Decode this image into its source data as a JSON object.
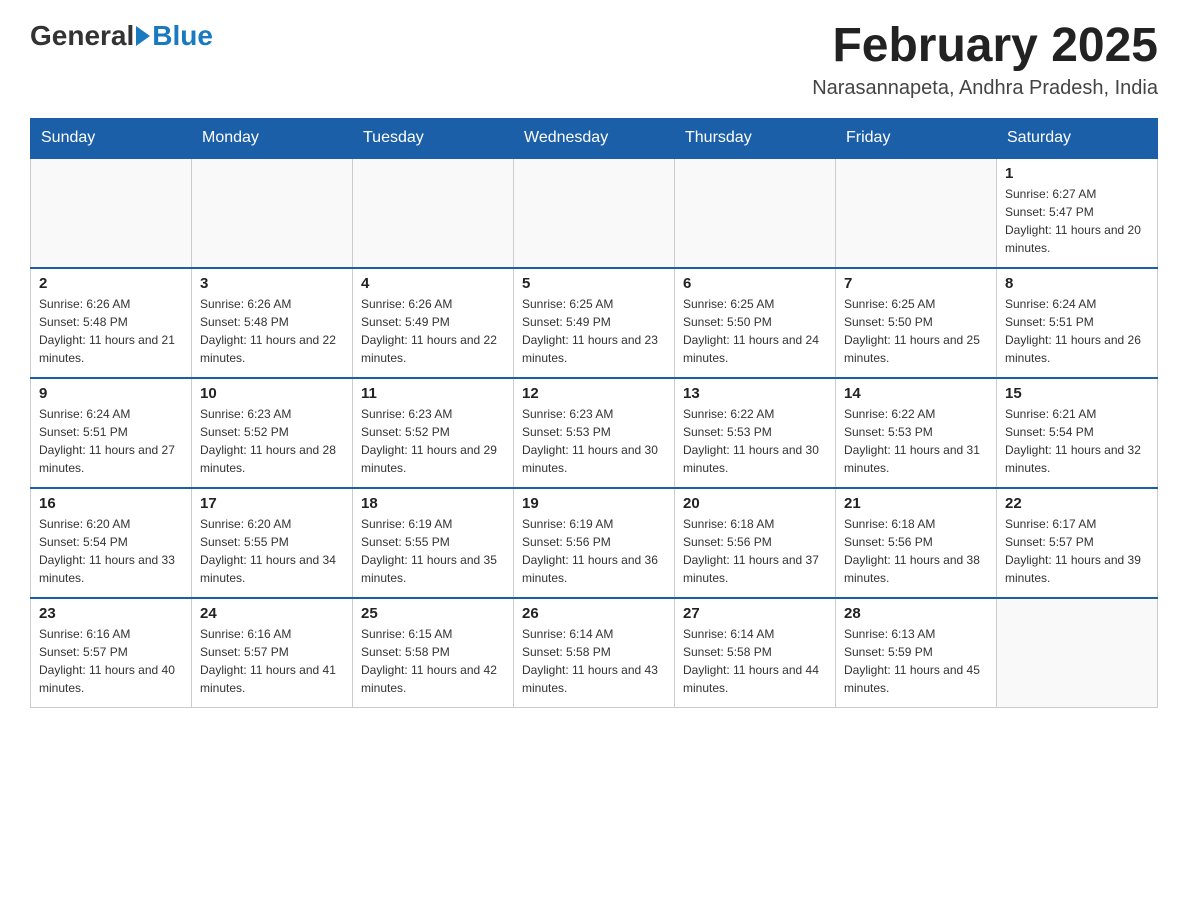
{
  "header": {
    "logo": {
      "general": "General",
      "blue": "Blue"
    },
    "title": "February 2025",
    "location": "Narasannapeta, Andhra Pradesh, India"
  },
  "days_of_week": [
    "Sunday",
    "Monday",
    "Tuesday",
    "Wednesday",
    "Thursday",
    "Friday",
    "Saturday"
  ],
  "weeks": [
    {
      "days": [
        {
          "number": "",
          "info": ""
        },
        {
          "number": "",
          "info": ""
        },
        {
          "number": "",
          "info": ""
        },
        {
          "number": "",
          "info": ""
        },
        {
          "number": "",
          "info": ""
        },
        {
          "number": "",
          "info": ""
        },
        {
          "number": "1",
          "info": "Sunrise: 6:27 AM\nSunset: 5:47 PM\nDaylight: 11 hours and 20 minutes."
        }
      ]
    },
    {
      "days": [
        {
          "number": "2",
          "info": "Sunrise: 6:26 AM\nSunset: 5:48 PM\nDaylight: 11 hours and 21 minutes."
        },
        {
          "number": "3",
          "info": "Sunrise: 6:26 AM\nSunset: 5:48 PM\nDaylight: 11 hours and 22 minutes."
        },
        {
          "number": "4",
          "info": "Sunrise: 6:26 AM\nSunset: 5:49 PM\nDaylight: 11 hours and 22 minutes."
        },
        {
          "number": "5",
          "info": "Sunrise: 6:25 AM\nSunset: 5:49 PM\nDaylight: 11 hours and 23 minutes."
        },
        {
          "number": "6",
          "info": "Sunrise: 6:25 AM\nSunset: 5:50 PM\nDaylight: 11 hours and 24 minutes."
        },
        {
          "number": "7",
          "info": "Sunrise: 6:25 AM\nSunset: 5:50 PM\nDaylight: 11 hours and 25 minutes."
        },
        {
          "number": "8",
          "info": "Sunrise: 6:24 AM\nSunset: 5:51 PM\nDaylight: 11 hours and 26 minutes."
        }
      ]
    },
    {
      "days": [
        {
          "number": "9",
          "info": "Sunrise: 6:24 AM\nSunset: 5:51 PM\nDaylight: 11 hours and 27 minutes."
        },
        {
          "number": "10",
          "info": "Sunrise: 6:23 AM\nSunset: 5:52 PM\nDaylight: 11 hours and 28 minutes."
        },
        {
          "number": "11",
          "info": "Sunrise: 6:23 AM\nSunset: 5:52 PM\nDaylight: 11 hours and 29 minutes."
        },
        {
          "number": "12",
          "info": "Sunrise: 6:23 AM\nSunset: 5:53 PM\nDaylight: 11 hours and 30 minutes."
        },
        {
          "number": "13",
          "info": "Sunrise: 6:22 AM\nSunset: 5:53 PM\nDaylight: 11 hours and 30 minutes."
        },
        {
          "number": "14",
          "info": "Sunrise: 6:22 AM\nSunset: 5:53 PM\nDaylight: 11 hours and 31 minutes."
        },
        {
          "number": "15",
          "info": "Sunrise: 6:21 AM\nSunset: 5:54 PM\nDaylight: 11 hours and 32 minutes."
        }
      ]
    },
    {
      "days": [
        {
          "number": "16",
          "info": "Sunrise: 6:20 AM\nSunset: 5:54 PM\nDaylight: 11 hours and 33 minutes."
        },
        {
          "number": "17",
          "info": "Sunrise: 6:20 AM\nSunset: 5:55 PM\nDaylight: 11 hours and 34 minutes."
        },
        {
          "number": "18",
          "info": "Sunrise: 6:19 AM\nSunset: 5:55 PM\nDaylight: 11 hours and 35 minutes."
        },
        {
          "number": "19",
          "info": "Sunrise: 6:19 AM\nSunset: 5:56 PM\nDaylight: 11 hours and 36 minutes."
        },
        {
          "number": "20",
          "info": "Sunrise: 6:18 AM\nSunset: 5:56 PM\nDaylight: 11 hours and 37 minutes."
        },
        {
          "number": "21",
          "info": "Sunrise: 6:18 AM\nSunset: 5:56 PM\nDaylight: 11 hours and 38 minutes."
        },
        {
          "number": "22",
          "info": "Sunrise: 6:17 AM\nSunset: 5:57 PM\nDaylight: 11 hours and 39 minutes."
        }
      ]
    },
    {
      "days": [
        {
          "number": "23",
          "info": "Sunrise: 6:16 AM\nSunset: 5:57 PM\nDaylight: 11 hours and 40 minutes."
        },
        {
          "number": "24",
          "info": "Sunrise: 6:16 AM\nSunset: 5:57 PM\nDaylight: 11 hours and 41 minutes."
        },
        {
          "number": "25",
          "info": "Sunrise: 6:15 AM\nSunset: 5:58 PM\nDaylight: 11 hours and 42 minutes."
        },
        {
          "number": "26",
          "info": "Sunrise: 6:14 AM\nSunset: 5:58 PM\nDaylight: 11 hours and 43 minutes."
        },
        {
          "number": "27",
          "info": "Sunrise: 6:14 AM\nSunset: 5:58 PM\nDaylight: 11 hours and 44 minutes."
        },
        {
          "number": "28",
          "info": "Sunrise: 6:13 AM\nSunset: 5:59 PM\nDaylight: 11 hours and 45 minutes."
        },
        {
          "number": "",
          "info": ""
        }
      ]
    }
  ]
}
